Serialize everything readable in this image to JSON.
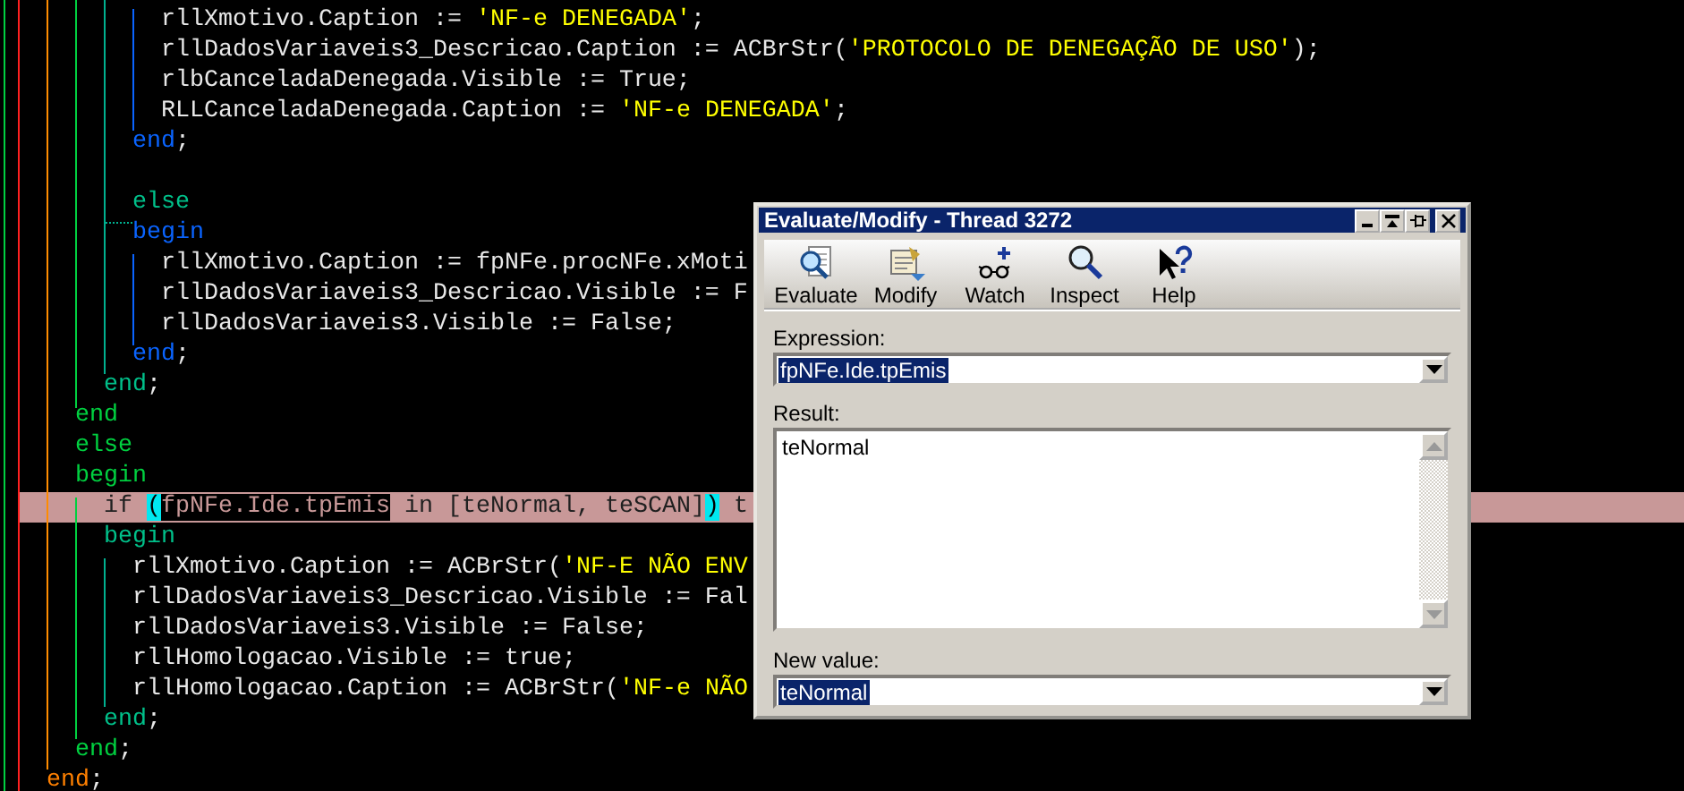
{
  "editor": {
    "lines": [
      {
        "current": false,
        "segments": [
          {
            "kind": "plain",
            "text": "          rllXmotivo.Caption := "
          },
          {
            "kind": "string",
            "text": "'NF-e DENEGADA'"
          },
          {
            "kind": "plain",
            "text": ";"
          }
        ]
      },
      {
        "current": false,
        "segments": [
          {
            "kind": "plain",
            "text": "          rllDadosVariaveis3_Descricao.Caption := ACBrStr("
          },
          {
            "kind": "string",
            "text": "'PROTOCOLO DE DENEGAÇÃO DE USO'"
          },
          {
            "kind": "plain",
            "text": ");"
          }
        ]
      },
      {
        "current": false,
        "segments": [
          {
            "kind": "plain",
            "text": "          rlbCanceladaDenegada.Visible := True;"
          }
        ]
      },
      {
        "current": false,
        "segments": [
          {
            "kind": "plain",
            "text": "          RLLCanceladaDenegada.Caption := "
          },
          {
            "kind": "string",
            "text": "'NF-e DENEGADA'"
          },
          {
            "kind": "plain",
            "text": ";"
          }
        ]
      },
      {
        "current": false,
        "segments": [
          {
            "kind": "keyword",
            "text": "        end",
            "color": "#0a64ff"
          },
          {
            "kind": "plain",
            "text": ";"
          }
        ]
      },
      {
        "current": false
      },
      {
        "current": false,
        "segments": [
          {
            "kind": "keyword",
            "text": "        else",
            "color": "#00c08a"
          }
        ]
      },
      {
        "current": false,
        "segments": [
          {
            "kind": "keyword",
            "text": "        begin",
            "color": "#0a64ff"
          }
        ]
      },
      {
        "current": false,
        "segments": [
          {
            "kind": "plain",
            "text": "          rllXmotivo.Caption := fpNFe.procNFe.xMoti"
          }
        ]
      },
      {
        "current": false,
        "segments": [
          {
            "kind": "plain",
            "text": "          rllDadosVariaveis3_Descricao.Visible := F"
          }
        ]
      },
      {
        "current": false,
        "segments": [
          {
            "kind": "plain",
            "text": "          rllDadosVariaveis3.Visible := False;"
          }
        ]
      },
      {
        "current": false,
        "segments": [
          {
            "kind": "keyword",
            "text": "        end",
            "color": "#0a64ff"
          },
          {
            "kind": "plain",
            "text": ";"
          }
        ]
      },
      {
        "current": false,
        "segments": [
          {
            "kind": "keyword",
            "text": "      end",
            "color": "#00c08a"
          },
          {
            "kind": "plain",
            "text": ";"
          }
        ]
      },
      {
        "current": false,
        "segments": [
          {
            "kind": "keyword",
            "text": "    end",
            "color": "#00d040"
          }
        ]
      },
      {
        "current": false,
        "segments": [
          {
            "kind": "keyword",
            "text": "    else",
            "color": "#00d040"
          }
        ]
      },
      {
        "current": false,
        "segments": [
          {
            "kind": "keyword",
            "text": "    begin",
            "color": "#00d040"
          }
        ]
      },
      {
        "current": true,
        "segments": [
          {
            "kind": "plain",
            "text": "      if "
          },
          {
            "kind": "brace-match",
            "text": "("
          },
          {
            "kind": "selection",
            "text": "fpNFe.Ide.tpEmis"
          },
          {
            "kind": "plain",
            "text": " in [teNormal, teSCAN]"
          },
          {
            "kind": "brace-match",
            "text": ")"
          },
          {
            "kind": "plain",
            "text": " t"
          }
        ]
      },
      {
        "current": false,
        "segments": [
          {
            "kind": "keyword",
            "text": "      begin",
            "color": "#00c08a"
          }
        ]
      },
      {
        "current": false,
        "segments": [
          {
            "kind": "plain",
            "text": "        rllXmotivo.Caption := ACBrStr("
          },
          {
            "kind": "string",
            "text": "'NF-E NÃO ENV"
          }
        ]
      },
      {
        "current": false,
        "segments": [
          {
            "kind": "plain",
            "text": "        rllDadosVariaveis3_Descricao.Visible := Fal"
          }
        ]
      },
      {
        "current": false,
        "segments": [
          {
            "kind": "plain",
            "text": "        rllDadosVariaveis3.Visible := False;"
          }
        ]
      },
      {
        "current": false,
        "segments": [
          {
            "kind": "plain",
            "text": "        rllHomologacao.Visible := true;"
          }
        ]
      },
      {
        "current": false,
        "segments": [
          {
            "kind": "plain",
            "text": "        rllHomologacao.Caption := ACBrStr("
          },
          {
            "kind": "string",
            "text": "'NF-e NÃO"
          }
        ]
      },
      {
        "current": false,
        "segments": [
          {
            "kind": "keyword",
            "text": "      end",
            "color": "#00c08a"
          },
          {
            "kind": "plain",
            "text": ";"
          }
        ]
      },
      {
        "current": false,
        "segments": [
          {
            "kind": "keyword",
            "text": "    end",
            "color": "#00d040"
          },
          {
            "kind": "plain",
            "text": ";"
          }
        ]
      },
      {
        "current": false,
        "segments": [
          {
            "kind": "keyword",
            "text": "  end",
            "color": "#ff8000"
          },
          {
            "kind": "plain",
            "text": ";"
          }
        ]
      }
    ]
  },
  "dialog": {
    "title": "Evaluate/Modify - Thread 3272",
    "toolbar": [
      {
        "kind": "evaluate",
        "label": "Evaluate"
      },
      {
        "kind": "modify",
        "label": "Modify"
      },
      {
        "kind": "watch",
        "label": "Watch"
      },
      {
        "kind": "inspect",
        "label": "Inspect"
      },
      {
        "kind": "help",
        "label": "Help"
      }
    ],
    "expression": {
      "label": "Expression:",
      "value": "fpNFe.Ide.tpEmis",
      "selected": true
    },
    "result": {
      "label": "Result:",
      "value": "teNormal"
    },
    "new_value": {
      "label": "New value:",
      "value": "teNormal",
      "selected": true
    }
  }
}
